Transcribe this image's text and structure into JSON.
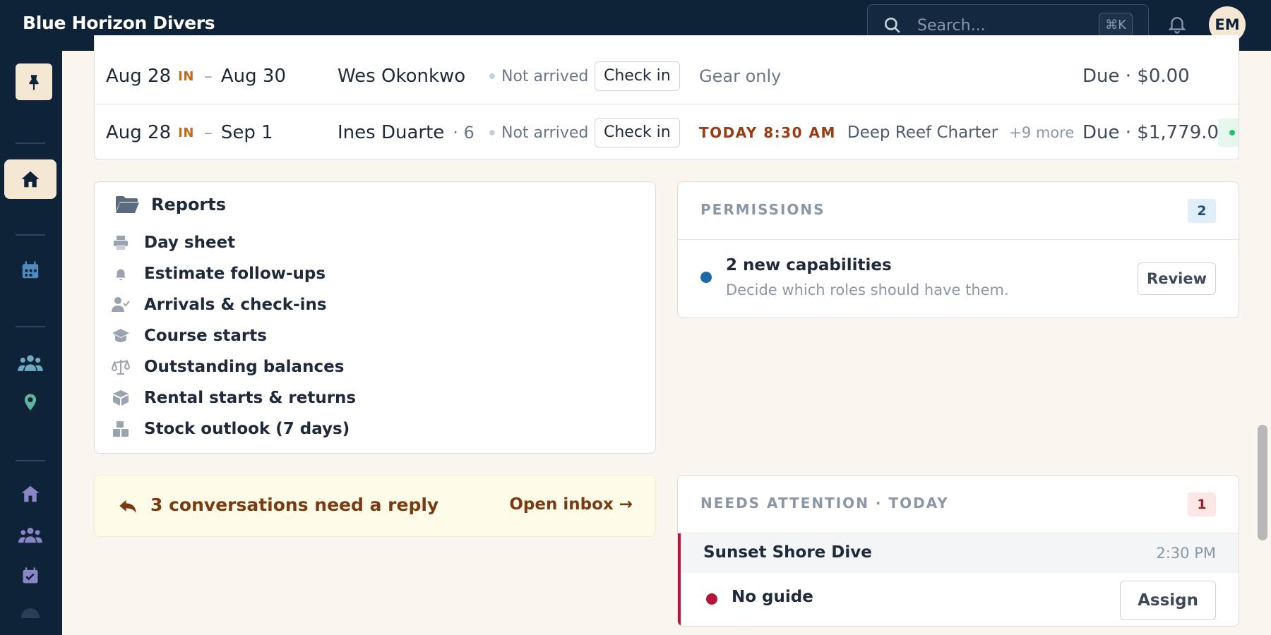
{
  "app": {
    "brand": "Blue Horizon Divers",
    "search_placeholder": "Search...",
    "search_shortcut": "⌘K",
    "user_initials": "EM"
  },
  "sidebar": {
    "items": [
      {
        "icon": "pin-icon"
      },
      {
        "icon": "home-icon",
        "active": true
      },
      {
        "icon": "calendar-icon"
      },
      {
        "icon": "users-icon"
      },
      {
        "icon": "location-pin-icon"
      },
      {
        "icon": "shop-icon"
      },
      {
        "icon": "people-icon"
      },
      {
        "icon": "task-calendar-icon"
      }
    ]
  },
  "arrivals": {
    "rows": [
      {
        "start": "Aug 28",
        "in_label": "IN",
        "end": "Aug 30",
        "guest": "Wes Okonkwo",
        "party_size": "",
        "status": "Not arrived",
        "action": "Check in",
        "service": "Gear only",
        "today_label": "",
        "trip": "",
        "more": "",
        "due": "Due · $0.00"
      },
      {
        "start": "Aug 28",
        "in_label": "IN",
        "end": "Sep 1",
        "guest": "Ines Duarte",
        "party_size": "· 6",
        "status": "Not arrived",
        "action": "Check in",
        "service": "",
        "today_label": "TODAY 8:30 AM",
        "trip": "Deep Reef Charter",
        "more": "+9 more",
        "due": "Due · $1,779.00"
      }
    ]
  },
  "reports": {
    "title": "Reports",
    "items": [
      {
        "label": "Day sheet",
        "icon": "printer-icon"
      },
      {
        "label": "Estimate follow-ups",
        "icon": "bell-icon"
      },
      {
        "label": "Arrivals & check-ins",
        "icon": "user-check-icon"
      },
      {
        "label": "Course starts",
        "icon": "graduation-cap-icon"
      },
      {
        "label": "Outstanding balances",
        "icon": "scale-icon"
      },
      {
        "label": "Rental starts & returns",
        "icon": "box-icon"
      },
      {
        "label": "Stock outlook (7 days)",
        "icon": "boxes-icon"
      }
    ]
  },
  "permissions": {
    "title": "PERMISSIONS",
    "count": "2",
    "item_title": "2 new capabilities",
    "item_subtitle": "Decide which roles should have them.",
    "action": "Review"
  },
  "conversations": {
    "text": "3 conversations need a reply",
    "link": "Open inbox →"
  },
  "attention": {
    "title": "NEEDS ATTENTION · TODAY",
    "count": "1",
    "event": "Sunset Shore Dive",
    "time": "2:30 PM",
    "issue": "No guide",
    "action": "Assign"
  },
  "colors": {
    "navy": "#0e2238",
    "cream": "#f4e8d4",
    "background": "#faf6ef",
    "accent_orange": "#c96a1a",
    "alert_red": "#b4133a",
    "info_blue": "#1a6aa8"
  }
}
